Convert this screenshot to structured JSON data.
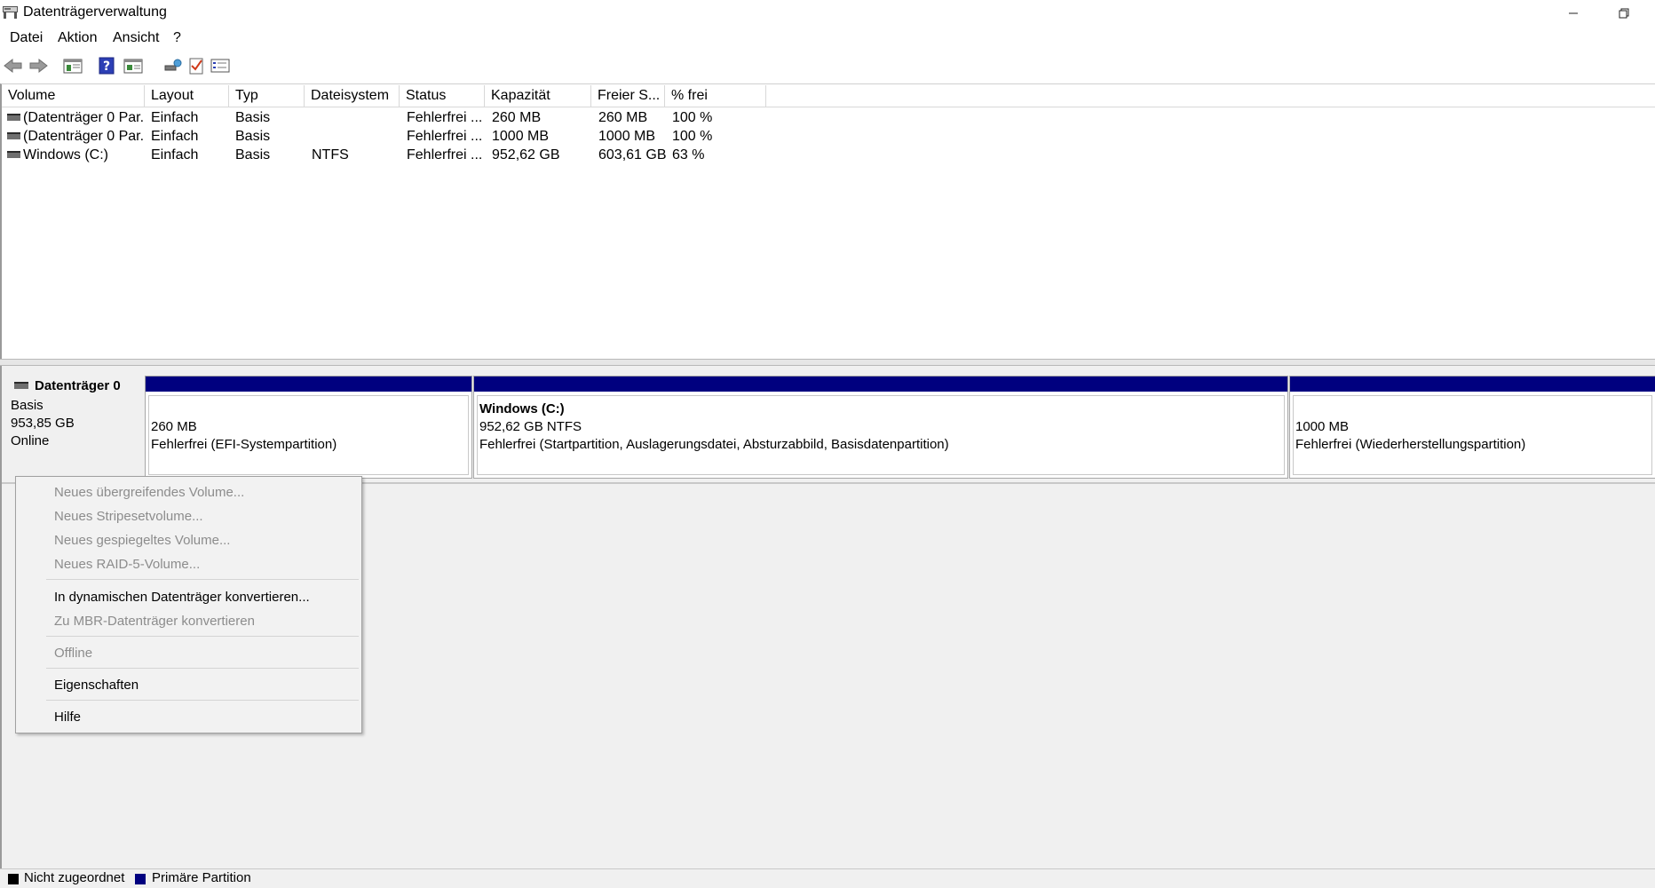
{
  "window": {
    "title": "Datenträgerverwaltung"
  },
  "menubar": {
    "items": [
      "Datei",
      "Aktion",
      "Ansicht",
      "?"
    ]
  },
  "toolbar": {
    "icons": [
      "back-arrow-icon",
      "forward-arrow-icon",
      "console-tree-icon",
      "help-icon",
      "properties-icon",
      "connect-icon",
      "check-icon",
      "list-view-icon"
    ]
  },
  "volume_list": {
    "columns": [
      "Volume",
      "Layout",
      "Typ",
      "Dateisystem",
      "Status",
      "Kapazität",
      "Freier S...",
      "% frei"
    ],
    "rows": [
      [
        "(Datenträger 0 Par...",
        "Einfach",
        "Basis",
        "",
        "Fehlerfrei ...",
        "260 MB",
        "260 MB",
        "100 %"
      ],
      [
        "(Datenträger 0 Par...",
        "Einfach",
        "Basis",
        "",
        "Fehlerfrei ...",
        "1000 MB",
        "1000 MB",
        "100 %"
      ],
      [
        "Windows (C:)",
        "Einfach",
        "Basis",
        "NTFS",
        "Fehlerfrei ...",
        "952,62 GB",
        "603,61 GB",
        "63 %"
      ]
    ]
  },
  "disk": {
    "name": "Datenträger 0",
    "type": "Basis",
    "size": "953,85 GB",
    "state": "Online",
    "partitions": [
      {
        "title": "",
        "size": "260 MB",
        "status": "Fehlerfrei (EFI-Systempartition)"
      },
      {
        "title": "Windows  (C:)",
        "size": "952,62 GB NTFS",
        "status": "Fehlerfrei (Startpartition, Auslagerungsdatei, Absturzabbild, Basisdatenpartition)"
      },
      {
        "title": "",
        "size": "1000 MB",
        "status": "Fehlerfrei (Wiederherstellungspartition)"
      }
    ]
  },
  "context_menu": {
    "items": [
      {
        "label": "Neues übergreifendes Volume...",
        "enabled": false
      },
      {
        "label": "Neues Stripesetvolume...",
        "enabled": false
      },
      {
        "label": "Neues gespiegeltes Volume...",
        "enabled": false
      },
      {
        "label": "Neues RAID-5-Volume...",
        "enabled": false
      },
      {
        "label": "In dynamischen Datenträger konvertieren...",
        "enabled": true
      },
      {
        "label": "Zu MBR-Datenträger konvertieren",
        "enabled": false
      },
      {
        "label": "Offline",
        "enabled": false
      },
      {
        "label": "Eigenschaften",
        "enabled": true
      },
      {
        "label": "Hilfe",
        "enabled": true
      }
    ]
  },
  "legend": {
    "items": [
      {
        "label": "Nicht zugeordnet",
        "color": "#000000"
      },
      {
        "label": "Primäre Partition",
        "color": "#00007f"
      }
    ]
  },
  "colors": {
    "partition_bar": "#00007f",
    "disabled_text": "#8c8c8c"
  }
}
